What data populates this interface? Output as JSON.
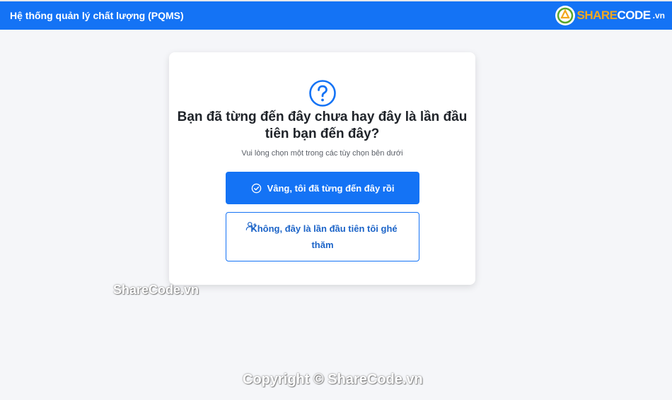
{
  "navbar": {
    "title": "Hệ thống quản lý chất lượng (PQMS)",
    "logo_share": "SHARE",
    "logo_code": "CODE",
    "logo_vn": ".vn"
  },
  "card": {
    "icon": "question-circle-icon",
    "title": "Bạn đã từng đến đây chưa hay đây là lần đầu tiên bạn đến đây?",
    "subtitle": "Vui lòng chọn một trong các tùy chọn bên dưới",
    "yes_button": {
      "icon": "check-circle-icon",
      "label": "Vâng, tôi đã từng đến đây rồi"
    },
    "no_button": {
      "icon": "user-plus-icon",
      "label": "Không, đây là lần đầu tiên tôi ghé thăm"
    }
  },
  "watermarks": {
    "middle": "ShareCode.vn",
    "copyright": "Copyright © ShareCode.vn"
  },
  "colors": {
    "primary": "#1473f5",
    "background": "#f5f6f9",
    "card": "#ffffff",
    "logo_orange": "#f2a81d"
  }
}
